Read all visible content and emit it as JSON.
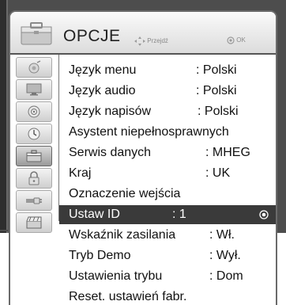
{
  "header": {
    "title": "OPCJE",
    "hint_move": "Przejdź",
    "hint_ok": "OK"
  },
  "sidebar": {
    "items": [
      {
        "icon": "picture-icon"
      },
      {
        "icon": "tv-screen-icon"
      },
      {
        "icon": "audio-icon"
      },
      {
        "icon": "clock-icon"
      },
      {
        "icon": "toolbox-icon",
        "active": true
      },
      {
        "icon": "lock-icon"
      },
      {
        "icon": "input-plug-icon"
      },
      {
        "icon": "clapperboard-icon"
      }
    ]
  },
  "menu": {
    "items": [
      {
        "label": "Język menu",
        "value": ": Polski"
      },
      {
        "label": "Język audio",
        "value": ": Polski"
      },
      {
        "label": "Język napisów",
        "value": ": Polski"
      },
      {
        "label": "Asystent niepełnosprawnych",
        "value": ""
      },
      {
        "label": "Serwis danych",
        "value": ": MHEG"
      },
      {
        "label": "Kraj",
        "value": ": UK"
      },
      {
        "label": "Oznaczenie wejścia",
        "value": ""
      },
      {
        "label": "Ustaw ID",
        "value": ": 1",
        "selected": true
      },
      {
        "label": "Wskaźnik zasilania",
        "value": ": Wł."
      },
      {
        "label": "Tryb Demo",
        "value": ": Wył."
      },
      {
        "label": "Ustawienia trybu",
        "value": ": Dom"
      },
      {
        "label": "Reset. ustawień fabr.",
        "value": ""
      }
    ]
  },
  "colors": {
    "selected_row": "#3a3a3a",
    "frame": "#4d4d4d"
  }
}
